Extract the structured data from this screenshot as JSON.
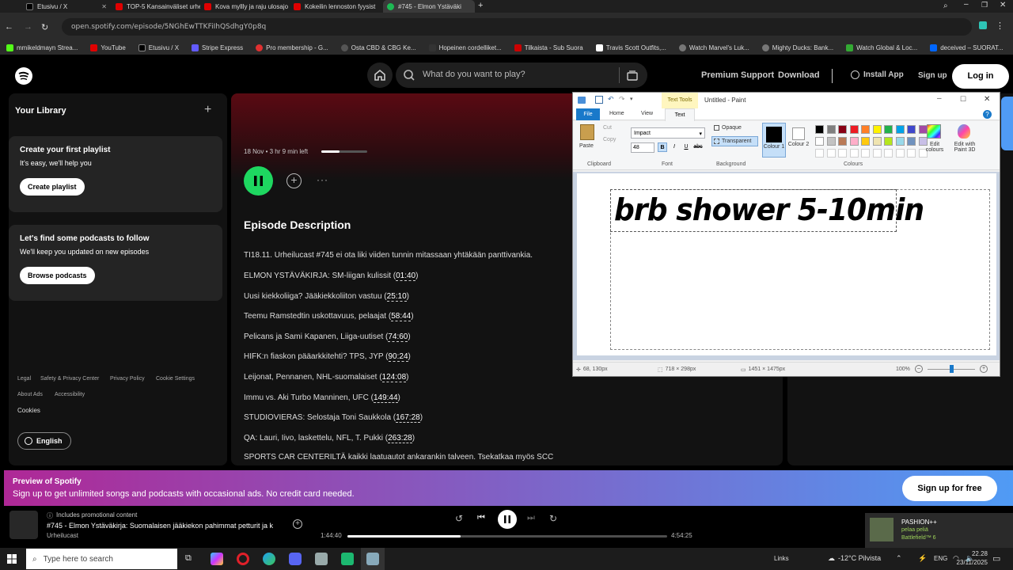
{
  "browser": {
    "tabs": [
      {
        "label": "Etusivu / X",
        "color": "#000000"
      },
      {
        "label": "TOP-5 Kansainväliset urhe",
        "color": "#e00000"
      },
      {
        "label": "Kova myllly ja raju ulosajo",
        "color": "#e00000"
      },
      {
        "label": "Kokeilin lennoston fyysist",
        "color": "#e00000"
      },
      {
        "label": "#745 - Elmon Ystäväki",
        "color": "#1db954"
      }
    ],
    "url": "open.spotify.com/episode/5NGhEwTTKFiIhQSdhgY0p8q",
    "bookmarks": [
      "mmikeldmayn Strea...",
      "YouTube",
      "Etusivu / X",
      "Stripe Express",
      "Pro membership - G...",
      "Osta CBD & CBG Ke...",
      "Hopeinen cordelliket...",
      "Tilkaista - Sub Suora",
      "Travis Scott Outfits,...",
      "Watch Marvel's Luk...",
      "Mighty Ducks: Bank...",
      "Watch Global & Loc...",
      "deceived – SUORAT..."
    ]
  },
  "spotify": {
    "search_placeholder": "What do you want to play?",
    "nav_links": [
      "Premium",
      "Support",
      "Download"
    ],
    "install_app": "Install App",
    "sign_up": "Sign up",
    "log_in": "Log in",
    "library": {
      "title": "Your Library",
      "card1_title": "Create your first playlist",
      "card1_sub": "It's easy, we'll help you",
      "card1_btn": "Create playlist",
      "card2_title": "Let's find some podcasts to follow",
      "card2_sub": "We'll keep you updated on new episodes",
      "card2_btn": "Browse podcasts",
      "footer_links": [
        "Legal",
        "Safety & Privacy Center",
        "Privacy Policy",
        "Cookie Settings",
        "About Ads",
        "Accessibility"
      ],
      "cookies": "Cookies",
      "language": "English"
    },
    "episode": {
      "meta": "18 Nov • 3 hr 9 min left",
      "progress_fraction": 0.4,
      "desc_heading": "Episode Description",
      "intro": "TI18.11. Urheilucast #745 ei ota liki viiden tunnin mitassaan yhtäkään panttivankia.",
      "chapters": [
        {
          "text": "ELMON YSTÄVÄKIRJA: SM-liigan kulissit",
          "time": "01:40"
        },
        {
          "text": "Uusi kiekkoliiga? Jääkiekkoliiton vastuu",
          "time": "25:10"
        },
        {
          "text": "Teemu Ramstedtin uskottavuus, pelaajat",
          "time": "58:44"
        },
        {
          "text": "Pelicans ja Sami Kapanen, Liiga-uutiset",
          "time": "74:60"
        },
        {
          "text": "HIFK:n fiaskon pääarkkitehti? TPS, JYP",
          "time": "90:24"
        },
        {
          "text": "Leijonat, Pennanen, NHL-suomalaiset",
          "time": "124:08"
        },
        {
          "text": "Immu vs. Aki Turbo Manninen, UFC",
          "time": "149:44"
        },
        {
          "text": "STUDIOVIERAS: Selostaja Toni Saukkola",
          "time": "167:28"
        },
        {
          "text": "QA: Lauri, Iivo, laskettelu, NFL, T. Pukki",
          "time": "263:28"
        }
      ],
      "last_line": "SPORTS CAR CENTERILTÄ kaikki laatuautot ankarankin talveen. Tsekatkaa myös SCC"
    },
    "preview": {
      "title": "Preview of Spotify",
      "sub": "Sign up to get unlimited songs and podcasts with occasional ads. No credit card needed.",
      "btn": "Sign up for free"
    },
    "player": {
      "promo": "Includes promotional content",
      "title": "#745 - Elmon Ystäväkirja: Suomalaisen jääkiekon pahimmat petturit ja k",
      "show": "Urheilucast",
      "elapsed": "1:44:40",
      "total": "4:54:25",
      "progress_fraction": 0.355
    }
  },
  "paint": {
    "title": "Untitled - Paint",
    "context_tab": "Text Tools",
    "tabs": [
      "File",
      "Home",
      "View",
      "Text"
    ],
    "font_name": "Impact",
    "font_size": "48",
    "cut": "Cut",
    "copy": "Copy",
    "paste": "Paste",
    "opaque": "Opaque",
    "transparent": "Transparent",
    "colour1": "Colour 1",
    "colour2": "Colour 2",
    "edit_colours": "Edit colours",
    "edit_paint3d": "Edit with Paint 3D",
    "groups": [
      "Clipboard",
      "Font",
      "Background",
      "Colours"
    ],
    "canvas_text": "brb shower 5-10min",
    "status_pos": "68, 130px",
    "status_sel": "718 × 298px",
    "status_size": "1451 × 1475px",
    "zoom": "100%",
    "palette": [
      "#000000",
      "#7f7f7f",
      "#880015",
      "#ed1c24",
      "#ff7f27",
      "#fff200",
      "#22b14c",
      "#00a2e8",
      "#3f48cc",
      "#a349a4",
      "#ffffff",
      "#c3c3c3",
      "#b97a57",
      "#ffaec9",
      "#ffc90e",
      "#efe4b0",
      "#b5e61d",
      "#99d9ea",
      "#7092be",
      "#c8bfe7"
    ]
  },
  "right_panel": {
    "game_title": "PASHION++",
    "game_status": "pelaa peliä",
    "game_name": "Battlefield™ 6"
  },
  "taskbar": {
    "search_placeholder": "Type here to search",
    "links": "Links",
    "weather": "-12°C Pilvista",
    "lang": "ENG",
    "time": "22.28",
    "date": "23/11/2025"
  }
}
